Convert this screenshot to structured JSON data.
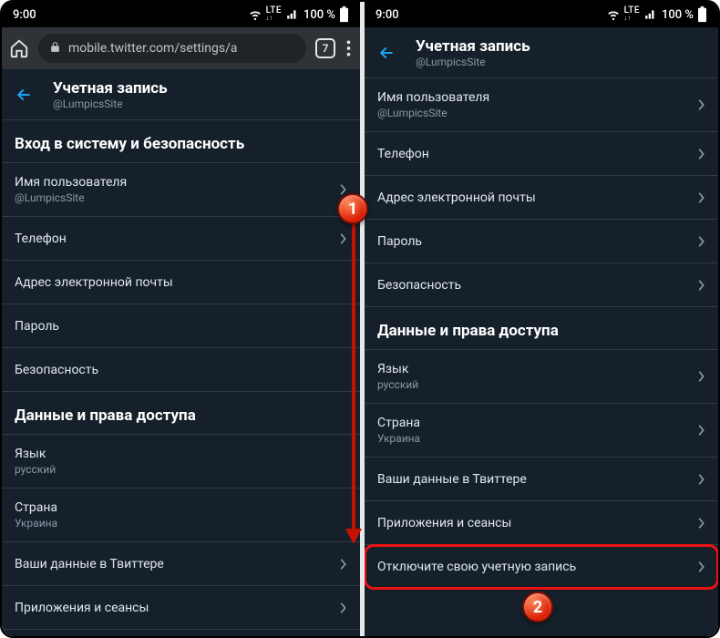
{
  "status": {
    "time": "9:00",
    "battery_text": "100 %",
    "lte": "LTE"
  },
  "browser": {
    "url": "mobile.twitter.com/settings/a",
    "tab_count": "7"
  },
  "header": {
    "title": "Учетная запись",
    "subtitle": "@LumpicsSite"
  },
  "left": {
    "section1": "Вход в систему и безопасность",
    "username_label": "Имя пользователя",
    "username_value": "@LumpicsSite",
    "phone": "Телефон",
    "email": "Адрес электронной почты",
    "password": "Пароль",
    "security": "Безопасность",
    "section2": "Данные и права доступа",
    "lang_label": "Язык",
    "lang_value": "русский",
    "country_label": "Страна",
    "country_value": "Украина",
    "yourdata": "Ваши данные в Твиттере",
    "apps": "Приложения и сеансы"
  },
  "right": {
    "username_label": "Имя пользователя",
    "username_value": "@LumpicsSite",
    "phone": "Телефон",
    "email": "Адрес электронной почты",
    "password": "Пароль",
    "security": "Безопасность",
    "section2": "Данные и права доступа",
    "lang_label": "Язык",
    "lang_value": "русский",
    "country_label": "Страна",
    "country_value": "Украина",
    "yourdata": "Ваши данные в Твиттере",
    "apps": "Приложения и сеансы",
    "deactivate": "Отключите свою учетную запись"
  },
  "annotations": {
    "marker1": "1",
    "marker2": "2"
  },
  "icons": {
    "wifi": "wifi-icon",
    "signal": "signal-icon",
    "battery": "battery-icon",
    "lock": "lock-icon",
    "home": "home-icon",
    "more": "more-icon",
    "back": "back-arrow-icon",
    "chevron": "chevron-right-icon"
  },
  "colors": {
    "accent": "#1da1f2",
    "bg": "#15202b",
    "border": "#2f3b47",
    "muted": "#8899a6",
    "danger": "#e11"
  }
}
